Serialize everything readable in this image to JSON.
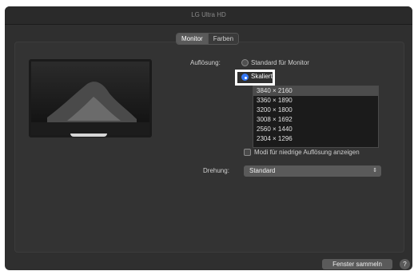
{
  "window": {
    "title": "LG Ultra HD"
  },
  "tabs": [
    {
      "label": "Monitor",
      "active": true
    },
    {
      "label": "Farben",
      "active": false
    }
  ],
  "resolution": {
    "label": "Auflösung:",
    "options": [
      {
        "label": "Standard für Monitor",
        "selected": false
      },
      {
        "label": "Skaliert",
        "selected": true
      }
    ],
    "scaled_list": [
      "3840 × 2160",
      "3360 × 1890",
      "3200 × 1800",
      "3008 × 1692",
      "2560 × 1440",
      "2304 × 1296"
    ],
    "selected_index": 0
  },
  "low_res_checkbox": {
    "label": "Modi für niedrige Auflösung anzeigen",
    "checked": false
  },
  "rotation": {
    "label": "Drehung:",
    "value": "Standard"
  },
  "footer": {
    "gather_button": "Fenster sammeln",
    "help_icon": "?"
  },
  "colors": {
    "window_bg": "#2f2f2f",
    "accent": "#3478f6",
    "control_bg": "#5a5a5a"
  },
  "icons": {
    "chevron": "updown-chevron-icon",
    "help": "help-icon"
  }
}
